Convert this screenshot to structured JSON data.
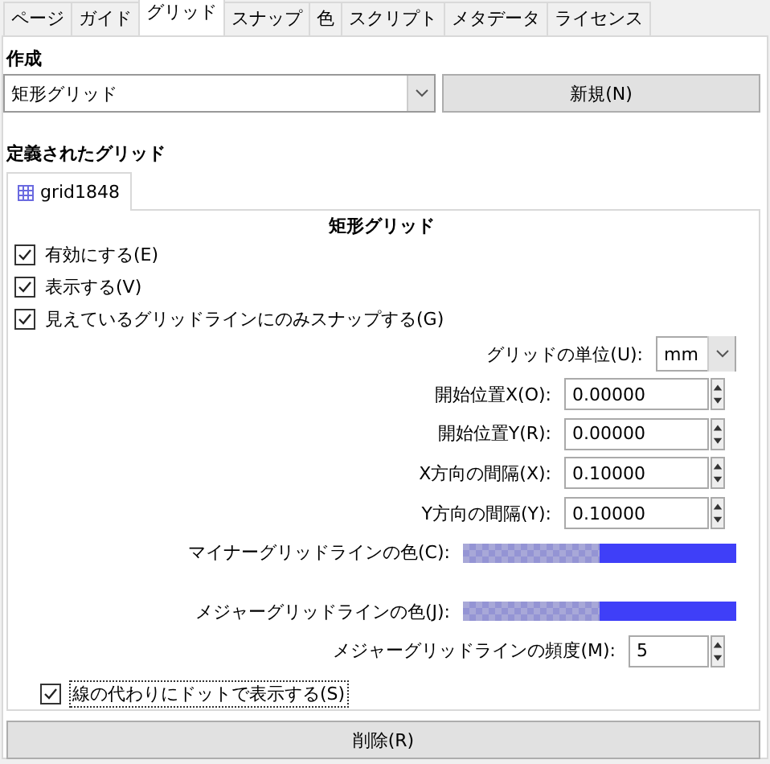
{
  "tabs": [
    {
      "label": "ページ",
      "selected": false
    },
    {
      "label": "ガイド",
      "selected": false
    },
    {
      "label": "グリッド",
      "selected": true
    },
    {
      "label": "スナップ",
      "selected": false
    },
    {
      "label": "色",
      "selected": false
    },
    {
      "label": "スクリプト",
      "selected": false
    },
    {
      "label": "メタデータ",
      "selected": false
    },
    {
      "label": "ライセンス",
      "selected": false
    }
  ],
  "create": {
    "heading": "作成",
    "type_value": "矩形グリッド",
    "new_button": "新規(N)"
  },
  "defined": {
    "heading": "定義されたグリッド",
    "grid_tabs": [
      {
        "label": "grid1848",
        "selected": true
      }
    ],
    "title": "矩形グリッド",
    "checkboxes": [
      {
        "label": "有効にする(E)",
        "checked": true
      },
      {
        "label": "表示する(V)",
        "checked": true
      },
      {
        "label": "見えているグリッドラインにのみスナップする(G)",
        "checked": true
      }
    ],
    "fields": [
      {
        "kind": "select",
        "label": "グリッドの単位(U):",
        "value": "mm"
      },
      {
        "kind": "spin",
        "label": "開始位置X(O):",
        "value": "0.00000"
      },
      {
        "kind": "spin",
        "label": "開始位置Y(R):",
        "value": "0.00000"
      },
      {
        "kind": "spin",
        "label": "X方向の間隔(X):",
        "value": "0.10000"
      },
      {
        "kind": "spin",
        "label": "Y方向の間隔(Y):",
        "value": "0.10000"
      },
      {
        "kind": "color",
        "label": "マイナーグリッドラインの色(C):",
        "color": "#3f3ff8"
      },
      {
        "kind": "gap"
      },
      {
        "kind": "color",
        "label": "メジャーグリッドラインの色(J):",
        "color": "#3f3ff8"
      },
      {
        "kind": "spin_short",
        "label": "メジャーグリッドラインの頻度(M):",
        "value": "5"
      }
    ],
    "dots_checkbox": {
      "label": "線の代わりにドットで表示する(S)",
      "checked": true
    }
  },
  "delete_button": "削除(R)"
}
